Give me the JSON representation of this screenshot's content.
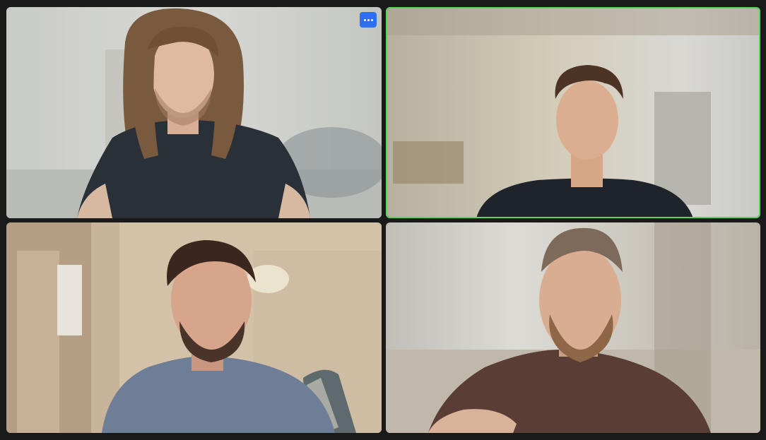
{
  "app": {
    "view": "gallery",
    "active_speaker_color": "#5ad35a",
    "accent_color": "#2d6ff0"
  },
  "participants": [
    {
      "tile": 1,
      "has_more_button": true,
      "active_speaker": false,
      "more_button_icon": "ellipsis-icon"
    },
    {
      "tile": 2,
      "has_more_button": false,
      "active_speaker": true
    },
    {
      "tile": 3,
      "has_more_button": false,
      "active_speaker": false
    },
    {
      "tile": 4,
      "has_more_button": false,
      "active_speaker": false
    }
  ]
}
